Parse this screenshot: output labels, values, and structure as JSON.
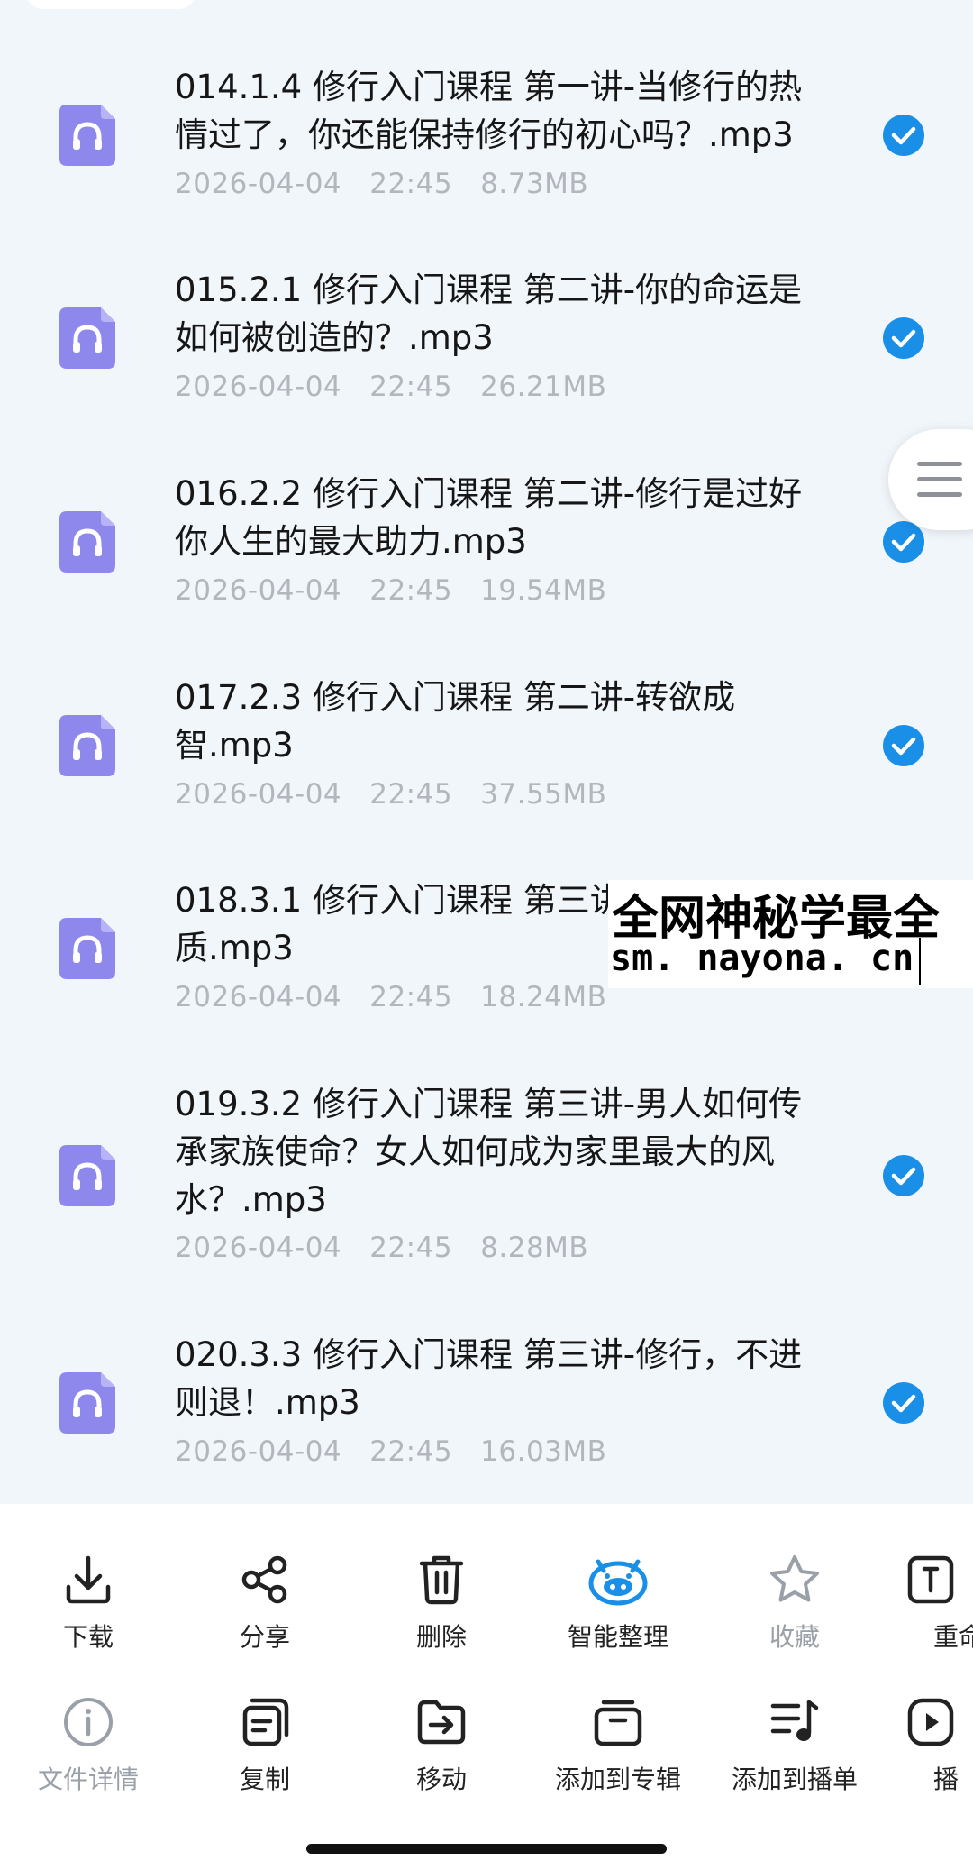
{
  "files": [
    {
      "title": "014.1.4 修行入门课程 第一讲-当修行的热\n情过了，你还能保持修行的初心吗？.mp3",
      "date": "2026-04-04",
      "time": "22:45",
      "size": "8.73MB",
      "selected": true
    },
    {
      "title": "015.2.1 修行入门课程 第二讲-你的命运是\n如何被创造的？.mp3",
      "date": "2026-04-04",
      "time": "22:45",
      "size": "26.21MB",
      "selected": true
    },
    {
      "title": "016.2.2 修行入门课程 第二讲-修行是过好\n你人生的最大助力.mp3",
      "date": "2026-04-04",
      "time": "22:45",
      "size": "19.54MB",
      "selected": true
    },
    {
      "title": "017.2.3 修行入门课程 第二讲-转欲成\n智.mp3",
      "date": "2026-04-04",
      "time": "22:45",
      "size": "37.55MB",
      "selected": true
    },
    {
      "title": "018.3.1 修行入门课程 第三讲\n质.mp3",
      "date": "2026-04-04",
      "time": "22:45",
      "size": "18.24MB",
      "selected": true
    },
    {
      "title": "019.3.2 修行入门课程 第三讲-男人如何传\n承家族使命？女人如何成为家里最大的风\n水？.mp3",
      "date": "2026-04-04",
      "time": "22:45",
      "size": "8.28MB",
      "selected": true
    },
    {
      "title": "020.3.3 修行入门课程 第三讲-修行，不进\n则退！.mp3",
      "date": "2026-04-04",
      "time": "22:45",
      "size": "16.03MB",
      "selected": true
    }
  ],
  "watermark": {
    "line1": "全网神秘学最全",
    "line2": "sm. nayona. cn"
  },
  "toolbar": {
    "row1": [
      {
        "icon": "download-icon",
        "label": "下载"
      },
      {
        "icon": "share-icon",
        "label": "分享"
      },
      {
        "icon": "trash-icon",
        "label": "删除"
      },
      {
        "icon": "smart-organize-icon",
        "label": "智能整理"
      },
      {
        "icon": "star-icon",
        "label": "收藏"
      },
      {
        "icon": "rename-icon",
        "label": "重命"
      }
    ],
    "row2": [
      {
        "icon": "info-icon",
        "label": "文件详情"
      },
      {
        "icon": "copy-icon",
        "label": "复制"
      },
      {
        "icon": "move-icon",
        "label": "移动"
      },
      {
        "icon": "album-icon",
        "label": "添加到专辑"
      },
      {
        "icon": "playlist-icon",
        "label": "添加到播单"
      },
      {
        "icon": "play-icon",
        "label": "播"
      }
    ]
  },
  "colors": {
    "accent": "#1a8fe8",
    "file_icon": "#8f88ec",
    "background": "#f1f6fb"
  }
}
